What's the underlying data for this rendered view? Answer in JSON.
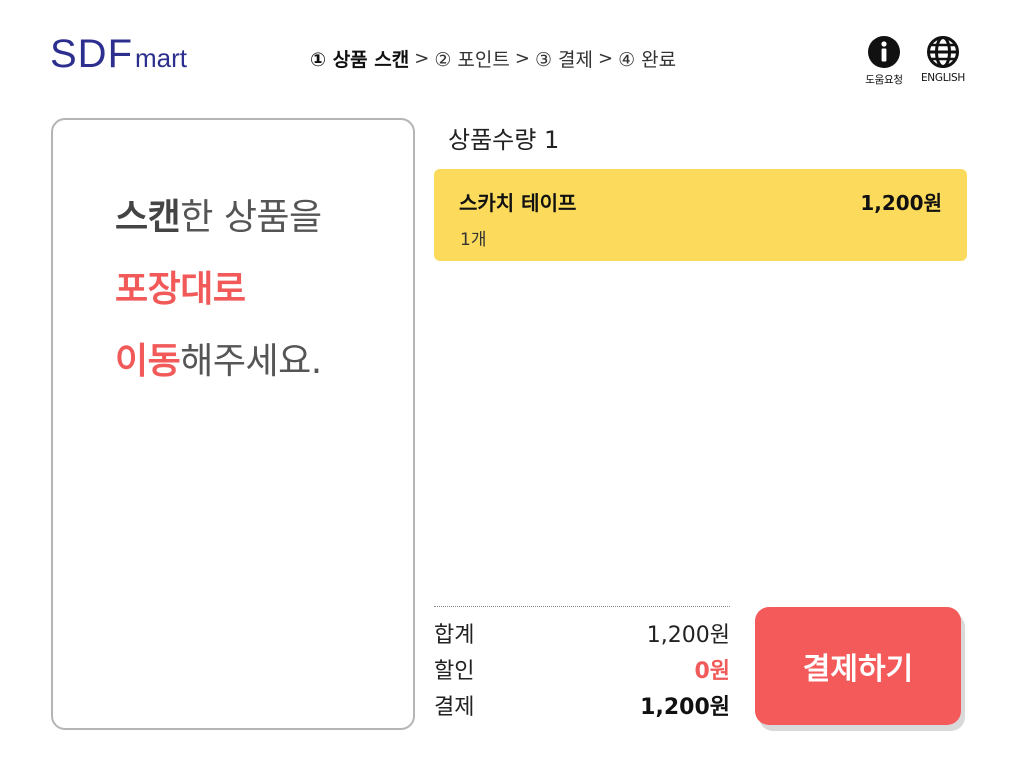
{
  "header": {
    "logo_big": "SDF",
    "logo_small": "mart",
    "steps": [
      {
        "label": "① 상품 스캔"
      },
      {
        "label": "② 포인트"
      },
      {
        "label": "③ 결제"
      },
      {
        "label": "④ 완료"
      }
    ],
    "step_separator": ">",
    "help_label": "도움요청",
    "lang_label": "ENGLISH",
    "help_icon": "info-icon",
    "lang_icon": "globe-icon"
  },
  "instruction": {
    "line1_strong": "스캔",
    "line1_rest": "한 상품을",
    "line2": "포장대로",
    "line3_strong": "이동",
    "line3_rest": "해주세요."
  },
  "cart": {
    "qty_label": "상품수량 1",
    "items": [
      {
        "name": "스카치 테이프",
        "count": "1개",
        "price": "1,200원"
      }
    ]
  },
  "summary": {
    "total_label": "합계",
    "total_value": "1,200원",
    "discount_label": "할인",
    "discount_value": "0원",
    "pay_label": "결제",
    "pay_value": "1,200원"
  },
  "pay_button": "결제하기",
  "colors": {
    "brand": "#2d2f8f",
    "accent_red": "#f45a5a",
    "item_bg": "#fcdb5c"
  }
}
